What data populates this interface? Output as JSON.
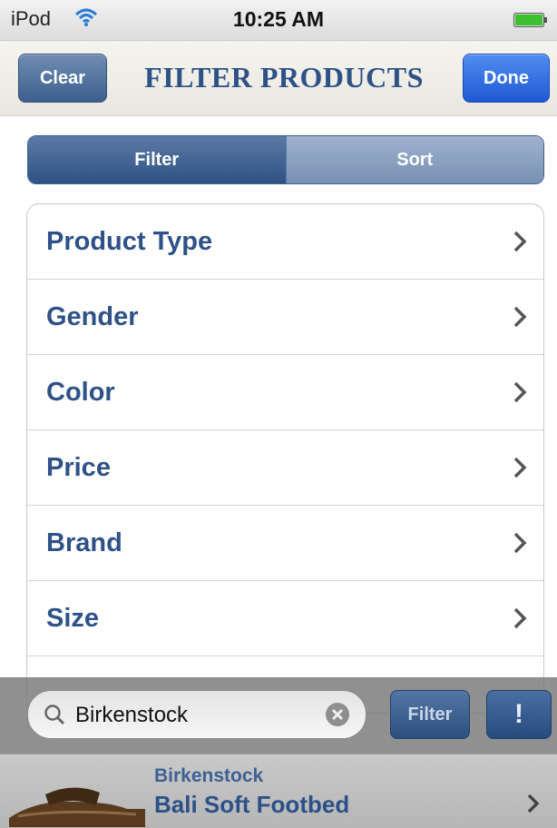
{
  "status_bar": {
    "carrier": "iPod",
    "time": "10:25 AM",
    "wifi_icon": "wifi-icon",
    "battery_icon": "battery-icon"
  },
  "nav_bar": {
    "clear_label": "Clear",
    "title": "FILTER PRODUCTS",
    "done_label": "Done"
  },
  "segmented": {
    "filter_label": "Filter",
    "sort_label": "Sort",
    "selected": "Filter"
  },
  "filter_list": {
    "items": [
      {
        "label": "Product Type"
      },
      {
        "label": "Gender"
      },
      {
        "label": "Color"
      },
      {
        "label": "Price"
      },
      {
        "label": "Brand"
      },
      {
        "label": "Size"
      }
    ]
  },
  "search": {
    "value": "Birkenstock",
    "filter_button": "Filter",
    "alert_button": "!"
  },
  "product": {
    "brand": "Birkenstock",
    "name": "Bali Soft Footbed"
  },
  "colors": {
    "accent_blue": "#2e5287",
    "done_blue": "#1f59d4"
  }
}
